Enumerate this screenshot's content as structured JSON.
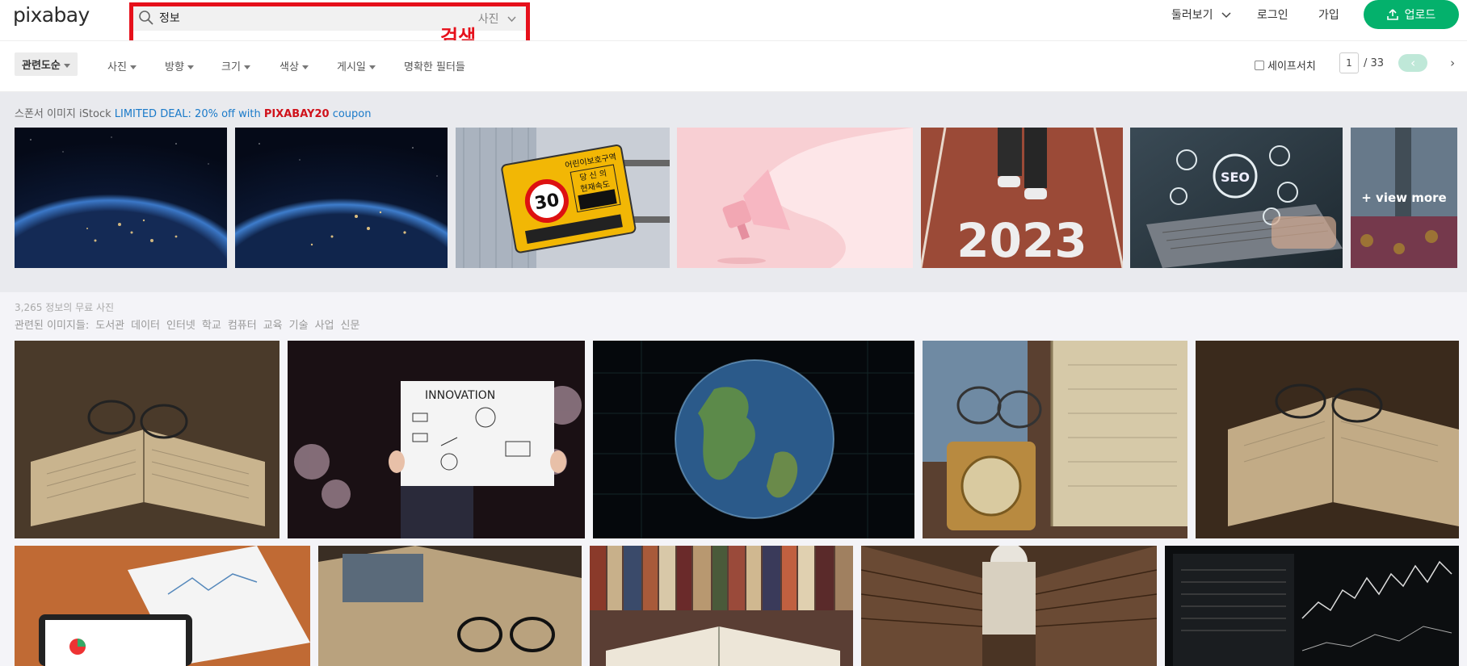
{
  "header": {
    "logo": "pixabay",
    "search": {
      "value": "정보",
      "type_label": "사진"
    },
    "annotation": "검색",
    "explore_label": "둘러보기",
    "login_label": "로그인",
    "join_label": "가입",
    "upload_label": "업로드"
  },
  "filters": {
    "sort": "관련도순",
    "items": [
      "사진",
      "방향",
      "크기",
      "색상",
      "게시일"
    ],
    "exact": "명확한 필터들",
    "safesearch": "세이프서치",
    "page_current": "1",
    "page_total": "/ 33",
    "prev": "‹",
    "next": "›"
  },
  "sponsored": {
    "prefix": "스폰서 이미지 iStock",
    "deal": "LIMITED DEAL: 20% off with",
    "code": "PIXABAY20",
    "suffix": "coupon",
    "view_more": "+ view more",
    "sign_text": [
      "어린이보호구역",
      "당 신 의",
      "현재속도",
      "30"
    ],
    "year_text": "2023",
    "seo_text": "SEO"
  },
  "results": {
    "count": "3,265 정보의 무료 사진",
    "related_label": "관련된 이미지들:",
    "related_tags": [
      "도서관",
      "데이터",
      "인터넷",
      "학교",
      "컴퓨터",
      "교육",
      "기술",
      "사업",
      "신문"
    ],
    "innovation_text": "INNOVATION"
  },
  "colors": {
    "brand_green": "#04b16c",
    "annotation_red": "#e6101b",
    "deal_blue": "#1a7ac9"
  }
}
